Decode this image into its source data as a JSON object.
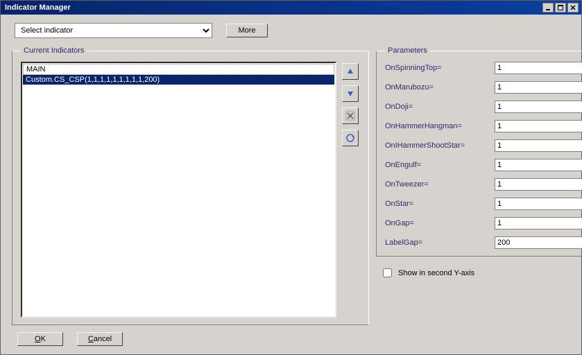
{
  "window": {
    "title": "Indicator Manager"
  },
  "topbar": {
    "dropdown_placeholder": "Select indicator",
    "more_label": "More"
  },
  "current_indicators": {
    "legend": "Current Indicators",
    "items": [
      {
        "label": "MAIN",
        "header": true,
        "selected": false
      },
      {
        "label": "Custom.CS_CSP(1,1,1,1,1,1,1,1,1,200)",
        "header": false,
        "selected": true
      }
    ],
    "side_buttons": {
      "up_icon": "triangle-up-icon",
      "down_icon": "triangle-down-icon",
      "delete_icon": "x-delete-icon",
      "configure_icon": "circle-arrow-icon"
    }
  },
  "parameters": {
    "legend": "Parameters",
    "rows": [
      {
        "label": "OnSpinningTop=",
        "value": "1"
      },
      {
        "label": "OnMarubozu=",
        "value": "1"
      },
      {
        "label": "OnDoji=",
        "value": "1"
      },
      {
        "label": "OnHammerHangman=",
        "value": "1"
      },
      {
        "label": "OnIHammerShootStar=",
        "value": "1"
      },
      {
        "label": "OnEngulf=",
        "value": "1"
      },
      {
        "label": "OnTweezer=",
        "value": "1"
      },
      {
        "label": "OnStar=",
        "value": "1"
      },
      {
        "label": "OnGap=",
        "value": "1"
      },
      {
        "label": "LabelGap=",
        "value": "200"
      }
    ],
    "show_second_y_label": "Show in second Y-axis",
    "show_second_y_checked": false
  },
  "footer": {
    "ok_label": "OK",
    "cancel_label": "Cancel"
  }
}
